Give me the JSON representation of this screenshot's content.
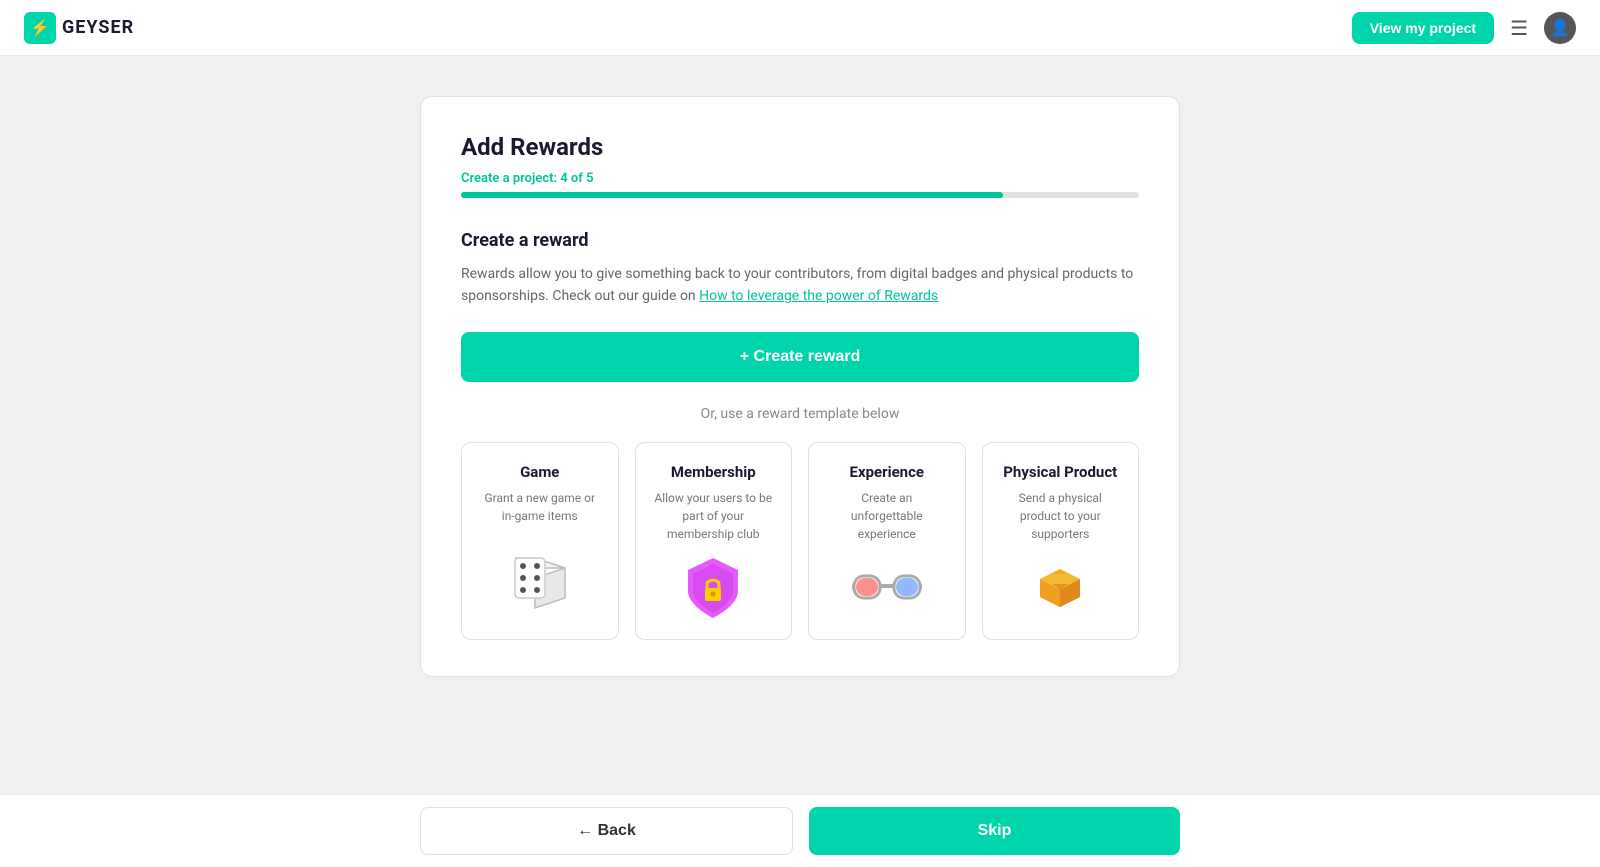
{
  "header": {
    "logo_text": "GEYSER",
    "view_project_btn": "View my project"
  },
  "page": {
    "title": "Add Rewards",
    "progress_label": "Create a project: 4 of 5",
    "progress_percent": 80,
    "section_title": "Create a reward",
    "section_desc_part1": "Rewards allow you to give something back to your contributors, from digital badges and physical products to sponsorships. Check out our guide on ",
    "section_desc_link": "How to leverage the power of Rewards",
    "create_reward_btn": "+ Create reward",
    "or_divider": "Or, use a reward template below",
    "templates": [
      {
        "title": "Game",
        "desc": "Grant a new game or in-game items",
        "icon": "🎲"
      },
      {
        "title": "Membership",
        "desc": "Allow your users to be part of your membership club",
        "icon": "shield"
      },
      {
        "title": "Experience",
        "desc": "Create an unforgettable experience",
        "icon": "glasses"
      },
      {
        "title": "Physical Product",
        "desc": "Send a physical product to your supporters",
        "icon": "📦"
      }
    ]
  },
  "footer": {
    "back_btn": "← Back",
    "skip_btn": "Skip"
  }
}
